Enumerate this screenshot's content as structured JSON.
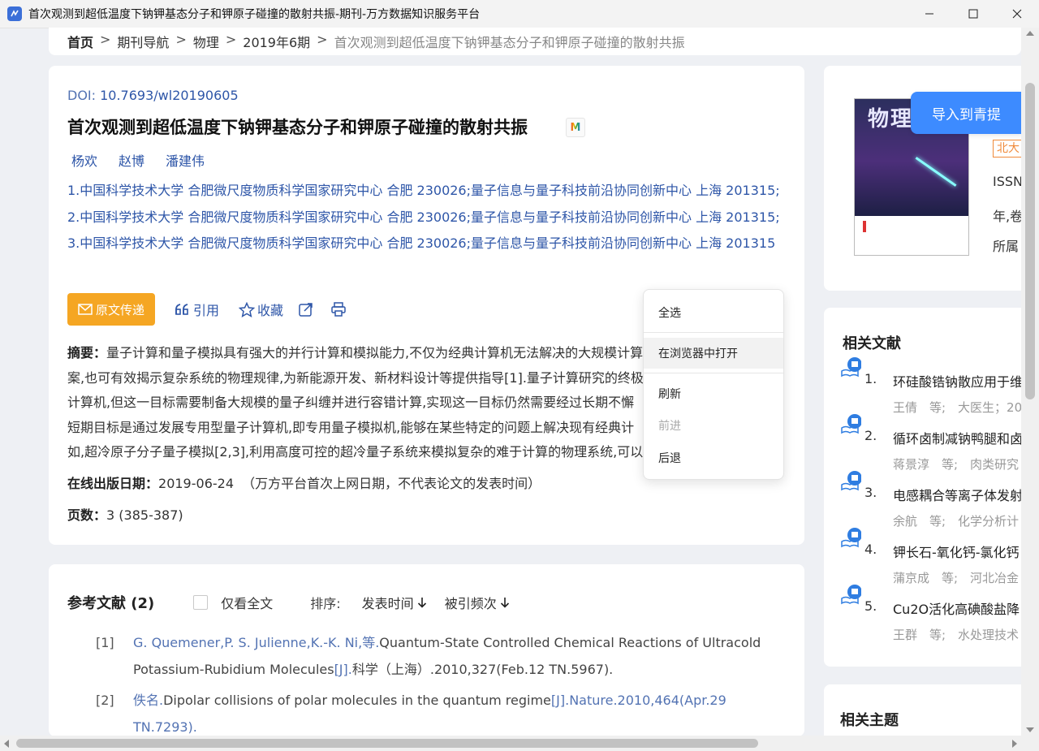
{
  "window": {
    "title": "首次观测到超低温度下钠钾基态分子和钾原子碰撞的散射共振-期刊-万方数据知识服务平台"
  },
  "breadcrumb": {
    "home": "首页",
    "journal_nav": "期刊导航",
    "journal": "物理",
    "issue": "2019年6期",
    "current": "首次观测到超低温度下钠钾基态分子和钾原子碰撞的散射共振",
    "separator": ">"
  },
  "paper": {
    "doi_label": "DOI: ",
    "doi_value": "10.7693/wl20190605",
    "title": "首次观测到超低温度下钠钾基态分子和钾原子碰撞的散射共振",
    "badge": "M",
    "authors": [
      "杨欢",
      "赵博",
      "潘建伟"
    ],
    "affiliations": "1.中国科学技术大学 合肥微尺度物质科学国家研究中心 合肥 230026;量子信息与量子科技前沿协同创新中心 上海 201315; 2.中国科学技术大学 合肥微尺度物质科学国家研究中心 合肥 230026;量子信息与量子科技前沿协同创新中心 上海 201315; 3.中国科学技术大学 合肥微尺度物质科学国家研究中心 合肥 230026;量子信息与量子科技前沿协同创新中心 上海 201315",
    "abstract_label": "摘要：",
    "abstract_lines": [
      "量子计算和量子模拟具有强大的并行计算和模拟能力,不仅为经典计算机无法解决的大规模计算",
      "案,也可有效揭示复杂系统的物理规律,为新能源开发、新材料设计等提供指导[1].量子计算研究的终极",
      "计算机,但这一目标需要制备大规模的量子纠缠并进行容错计算,实现这一目标仍然需要经过长期不懈",
      "短期目标是通过发展专用型量子计算机,即专用量子模拟机,能够在某些特定的问题上解决现有经典计",
      "如,超冷原子分子量子模拟[2,3],利用高度可控的超冷量子系统来模拟复杂的难于计算的物理系统,可以"
    ],
    "pubdate_label": "在线出版日期：",
    "pubdate_value": "2019-06-24",
    "pubdate_note": "（万方平台首次上网日期，不代表论文的发表时间）",
    "pages_label": "页数：",
    "pages_value": "3 (385-387)"
  },
  "actions": {
    "transfer": "原文传递",
    "cite": "引用",
    "favorite": "收藏"
  },
  "references": {
    "title": "参考文献 (2)",
    "fulltext_only": "仅看全文",
    "sort_label": "排序:",
    "sort_pubtime": "发表时间",
    "sort_cited": "被引频次",
    "items": [
      {
        "num": "[1]",
        "authors": "G. Quemener,P. S. Julienne,K.-K. Ni,等.",
        "title": "Quantum-State Controlled Chemical Reactions of Ultracold Potassium-Rubidium Molecules",
        "type": "[J].",
        "source": "科学（上海）.2010,327(Feb.12 TN.5967)."
      },
      {
        "num": "[2]",
        "authors": "佚名.",
        "title": "Dipolar collisions of polar molecules in the quantum regime",
        "type": "[J].",
        "source": "Nature.2010,464(Apr.29 TN.7293)."
      }
    ]
  },
  "journal": {
    "cover_title": "物理",
    "import_button": "导入到青提",
    "tag": "北大",
    "issn": "ISSN",
    "year_vol": "年,卷",
    "affiliation": "所属"
  },
  "related": {
    "title": "相关文献",
    "items": [
      {
        "num": "1.",
        "title": "环硅酸锆钠散应用于维",
        "meta": "王倩　等;　大医生；20"
      },
      {
        "num": "2.",
        "title": "循环卤制减钠鸭腿和卤",
        "meta": "蒋景淳　等;　肉类研究"
      },
      {
        "num": "3.",
        "title": "电感耦合等离子体发射",
        "meta": "余航　等;　化学分析计"
      },
      {
        "num": "4.",
        "title": "钾长石-氧化钙-氯化钙",
        "meta": "蒲京成　等;　河北冶金"
      },
      {
        "num": "5.",
        "title": "Cu2O活化高碘酸盐降",
        "meta": "王群　等;　水处理技术"
      }
    ]
  },
  "topics": {
    "title": "相关主题"
  },
  "context_menu": {
    "select_all": "全选",
    "open_in_browser": "在浏览器中打开",
    "refresh": "刷新",
    "forward": "前进",
    "back": "后退"
  },
  "colors": {
    "link_blue": "#2e56a8",
    "transfer_orange": "#f5a623",
    "import_blue": "#3d8bff",
    "tag_orange": "#f08a3a"
  }
}
